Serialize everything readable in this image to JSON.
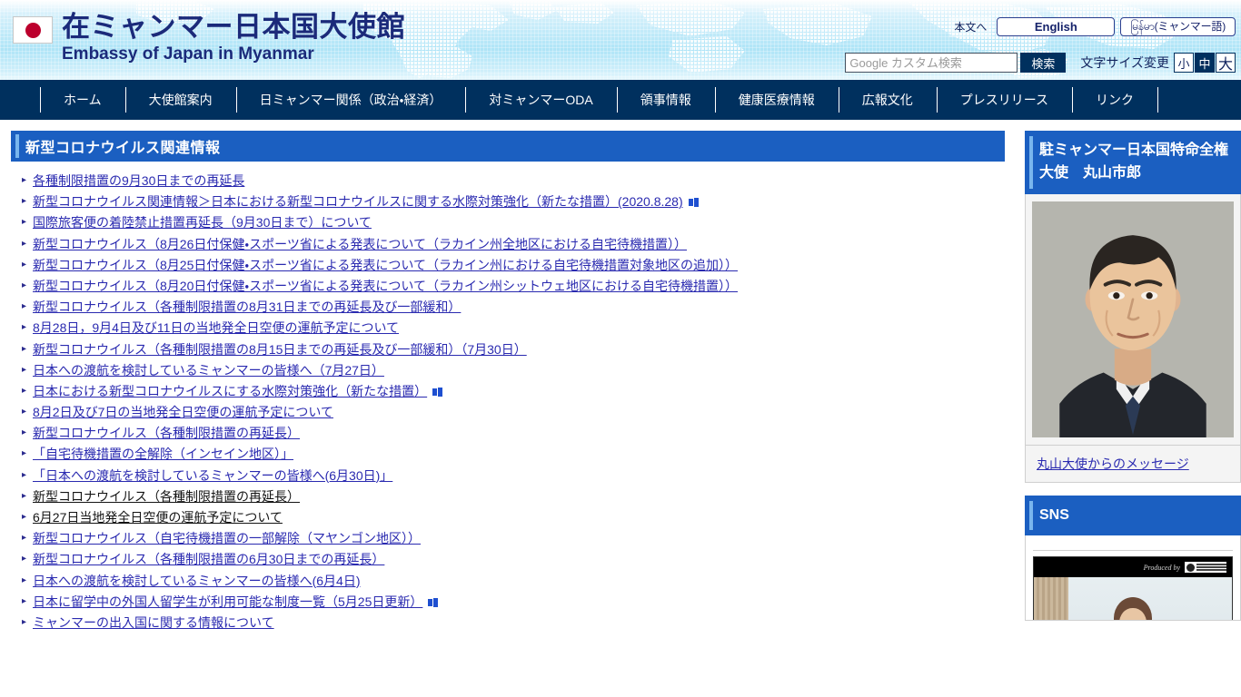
{
  "header": {
    "flag_icon": "japan-flag-icon",
    "title_jp": "在ミャンマー日本国大使館",
    "title_en": "Embassy of Japan in Myanmar",
    "skip_link": "本文へ",
    "lang_english": "English",
    "lang_myanmar": "မြန်မာ(ミャンマー語)",
    "search": {
      "placeholder": "Google カスタム検索",
      "value": "",
      "button": "検索"
    },
    "font_size": {
      "label": "文字サイズ変更",
      "options": [
        "小",
        "中",
        "大"
      ],
      "selected": "中"
    }
  },
  "nav": {
    "items": [
      {
        "label": "ホーム"
      },
      {
        "label": "大使館案内"
      },
      {
        "label": "日ミャンマー関係（政治・経済）"
      },
      {
        "label": "対ミャンマーODA"
      },
      {
        "label": "領事情報"
      },
      {
        "label": "健康医療情報"
      },
      {
        "label": "広報文化"
      },
      {
        "label": "プレスリリース"
      },
      {
        "label": "リンク"
      }
    ]
  },
  "main": {
    "section_title": "新型コロナウイルス関連情報",
    "links": [
      {
        "text": "各種制限措置の9月30日までの再延長",
        "external": false,
        "visited": false
      },
      {
        "text": "新型コロナウイルス関連情報＞日本における新型コロナウイルスに関する水際対策強化（新たな措置）(2020.8.28)",
        "external": true,
        "visited": false
      },
      {
        "text": "国際旅客便の着陸禁止措置再延長（9月30日まで）について",
        "external": false,
        "visited": false
      },
      {
        "text": "新型コロナウイルス（8月26日付保健・スポーツ省による発表について（ラカイン州全地区における自宅待機措置））",
        "external": false,
        "visited": false
      },
      {
        "text": "新型コロナウイルス（8月25日付保健・スポーツ省による発表について（ラカイン州における自宅待機措置対象地区の追加））",
        "external": false,
        "visited": false
      },
      {
        "text": "新型コロナウイルス（8月20日付保健・スポーツ省による発表について（ラカイン州シットウェ地区における自宅待機措置））",
        "external": false,
        "visited": false
      },
      {
        "text": "新型コロナウイルス（各種制限措置の8月31日までの再延長及び一部緩和）",
        "external": false,
        "visited": false
      },
      {
        "text": "8月28日，9月4日及び11日の当地発全日空便の運航予定について",
        "external": false,
        "visited": false
      },
      {
        "text": "新型コロナウイルス（各種制限措置の8月15日までの再延長及び一部緩和）（7月30日）",
        "external": false,
        "visited": false
      },
      {
        "text": "日本への渡航を検討しているミャンマーの皆様へ（7月27日）",
        "external": false,
        "visited": false
      },
      {
        "text": "日本における新型コロナウイルスにする水際対策強化（新たな措置）",
        "external": true,
        "visited": false
      },
      {
        "text": "8月2日及び7日の当地発全日空便の運航予定について",
        "external": false,
        "visited": false
      },
      {
        "text": "新型コロナウイルス（各種制限措置の再延長）",
        "external": false,
        "visited": false
      },
      {
        "text": "「自宅待機措置の全解除（インセイン地区）」",
        "external": false,
        "visited": false
      },
      {
        "text": "「日本への渡航を検討しているミャンマーの皆様へ(6月30日)」",
        "external": false,
        "visited": false
      },
      {
        "text": "新型コロナウイルス（各種制限措置の再延長）",
        "external": false,
        "visited": true
      },
      {
        "text": "6月27日当地発全日空便の運航予定について",
        "external": false,
        "visited": true
      },
      {
        "text": "新型コロナウイルス（自宅待機措置の一部解除（マヤンゴン地区））",
        "external": false,
        "visited": false
      },
      {
        "text": "新型コロナウイルス（各種制限措置の6月30日までの再延長）",
        "external": false,
        "visited": false
      },
      {
        "text": "日本への渡航を検討しているミャンマーの皆様へ(6月4日)",
        "external": false,
        "visited": false
      },
      {
        "text": "日本に留学中の外国人留学生が利用可能な制度一覧（5月25日更新）",
        "external": true,
        "visited": false
      },
      {
        "text": "ミャンマーの出入国に関する情報について",
        "external": false,
        "visited": false
      }
    ]
  },
  "sidebar": {
    "ambassador": {
      "heading": "駐ミャンマー日本国特命全権大使　丸山市郎",
      "photo_alt": "ambassador-photo",
      "message_link": "丸山大使からのメッセージ"
    },
    "sns": {
      "heading": "SNS",
      "video_credit": "Produced by",
      "video_alt": "sns-video-thumbnail"
    }
  },
  "colors": {
    "nav_bg": "#00305e",
    "heading_bg": "#1b5fc1",
    "heading_accent": "#79b6ee",
    "link": "#2a2ab0",
    "link_visited": "#141414",
    "title_text": "#1b2a7a",
    "flag_red": "#bc002d"
  }
}
